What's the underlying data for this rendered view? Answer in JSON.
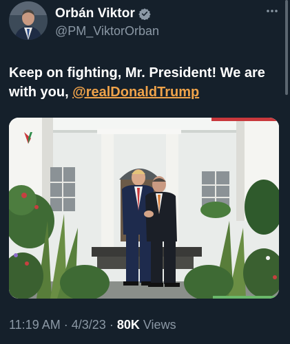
{
  "author": {
    "display_name": "Orbán Viktor",
    "handle": "@PM_ViktorOrban"
  },
  "tweet": {
    "text": "Keep on fighting, Mr. President! We are with you, ",
    "mention": "@realDonaldTrump"
  },
  "meta": {
    "time": "11:19 AM",
    "date": "4/3/23",
    "views_count": "80K",
    "views_label": "Views",
    "separator": "·"
  },
  "icons": {
    "verified": "verified-badge-icon",
    "more": "more-options-icon"
  },
  "colors": {
    "background": "#15202b",
    "mention": "#f0a34a",
    "muted": "#8b98a5"
  }
}
